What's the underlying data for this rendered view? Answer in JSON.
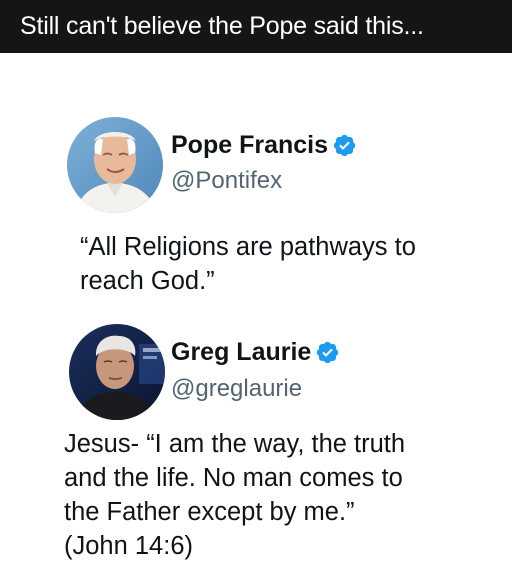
{
  "caption": "Still can't believe the Pope said this...",
  "colors": {
    "caption_bg": "#151515",
    "text": "#0f1419",
    "handle": "#536471",
    "verified": "#1d9bf0"
  },
  "posts": [
    {
      "name": "Pope Francis",
      "handle": "@Pontifex",
      "verified": true,
      "avatar_icon": "pope-avatar",
      "lines": [
        "“All Religions are pathways to",
        "reach God.”"
      ]
    },
    {
      "name": "Greg Laurie",
      "handle": "@greglaurie",
      "verified": true,
      "avatar_icon": "greg-avatar",
      "lines": [
        "Jesus- “I am the way, the truth",
        "and the life. No man comes to",
        "the Father except by me.”",
        "(John 14:6)"
      ]
    }
  ]
}
